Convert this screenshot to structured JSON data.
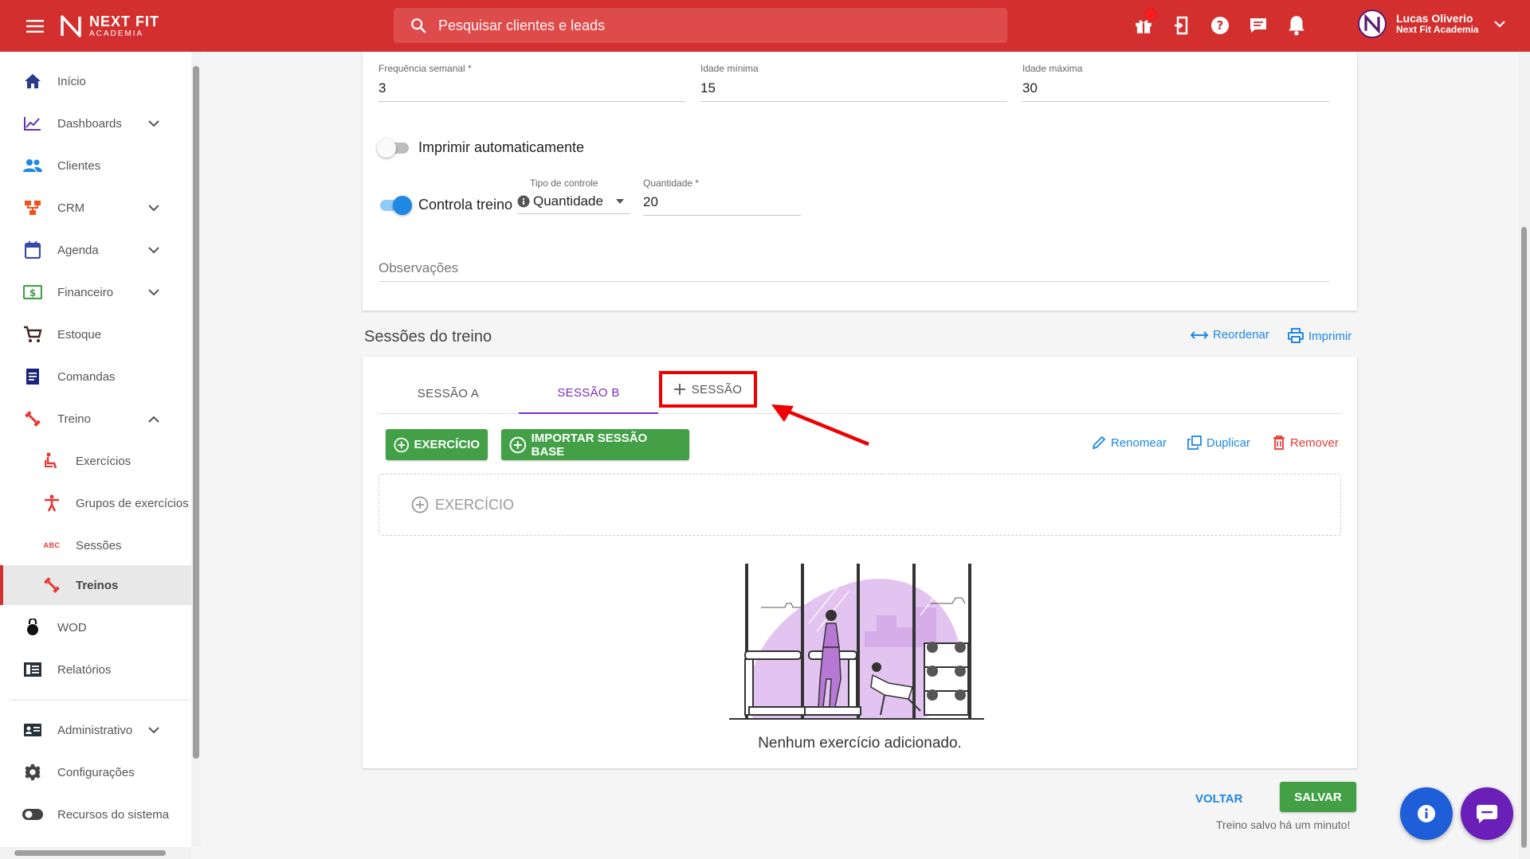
{
  "header": {
    "logo_line1": "NEXT FIT",
    "logo_line2": "ACADEMIA",
    "search_placeholder": "Pesquisar clientes e leads",
    "user_name": "Lucas Oliverio",
    "user_org": "Next Fit Academia"
  },
  "sidebar": {
    "items": [
      {
        "label": "Início"
      },
      {
        "label": "Dashboards"
      },
      {
        "label": "Clientes"
      },
      {
        "label": "CRM"
      },
      {
        "label": "Agenda"
      },
      {
        "label": "Financeiro"
      },
      {
        "label": "Estoque"
      },
      {
        "label": "Comandas"
      },
      {
        "label": "Treino"
      },
      {
        "label": "Exercícios"
      },
      {
        "label": "Grupos de exercícios"
      },
      {
        "label": "Sessões"
      },
      {
        "label": "Treinos"
      },
      {
        "label": "WOD"
      },
      {
        "label": "Relatórios"
      },
      {
        "label": "Administrativo"
      },
      {
        "label": "Configurações"
      },
      {
        "label": "Recursos do sistema"
      }
    ],
    "sessoes_icon_text": "ABC"
  },
  "config": {
    "freq_label": "Frequência semanal *",
    "freq_value": "3",
    "idade_min_label": "Idade mínima",
    "idade_min_value": "15",
    "idade_max_label": "Idade máxima",
    "idade_max_value": "30",
    "imprimir_label": "Imprimir automaticamente",
    "controla_label": "Controla treino",
    "tipo_label": "Tipo de controle",
    "tipo_value": "Quantidade",
    "qtd_label": "Quantidade *",
    "qtd_value": "20",
    "obs_placeholder": "Observações"
  },
  "sessions": {
    "title": "Sessões do treino",
    "reordenar": "Reordenar",
    "imprimir": "Imprimir",
    "tabs": [
      {
        "label": "SESSÃO A"
      },
      {
        "label": "SESSÃO B"
      },
      {
        "label": "SESSÃO"
      }
    ],
    "btn_exercicio": "EXERCÍCIO",
    "btn_importar": "IMPORTAR SESSÃO BASE",
    "renomear": "Renomear",
    "duplicar": "Duplicar",
    "remover": "Remover",
    "dropzone_label": "EXERCÍCIO",
    "empty_text": "Nenhum exercício adicionado."
  },
  "footer": {
    "voltar": "VOLTAR",
    "salvar": "SALVAR",
    "status": "Treino salvo há um minuto!"
  },
  "colors": {
    "brand_red": "#d32f2f",
    "accent_purple": "#7b2cbf",
    "action_blue": "#1e88e5",
    "success_green": "#43a047",
    "danger_red": "#e53935"
  }
}
